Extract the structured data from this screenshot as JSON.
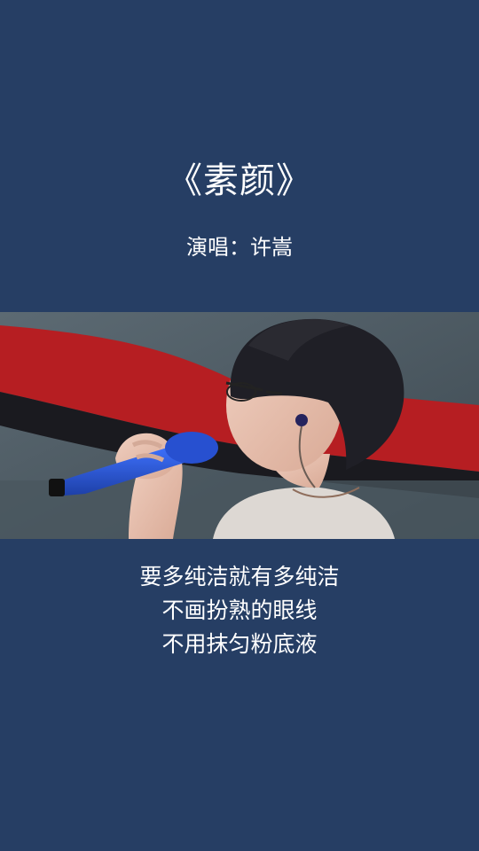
{
  "song": {
    "title": "《素颜》",
    "singer_line": "演唱：许嵩"
  },
  "lyrics": [
    "要多纯洁就有多纯洁",
    "不画扮熟的眼线",
    "不用抹匀粉底液"
  ],
  "colors": {
    "background": "#263e64",
    "text": "#ffffff",
    "microphone": "#1f4fbf"
  }
}
